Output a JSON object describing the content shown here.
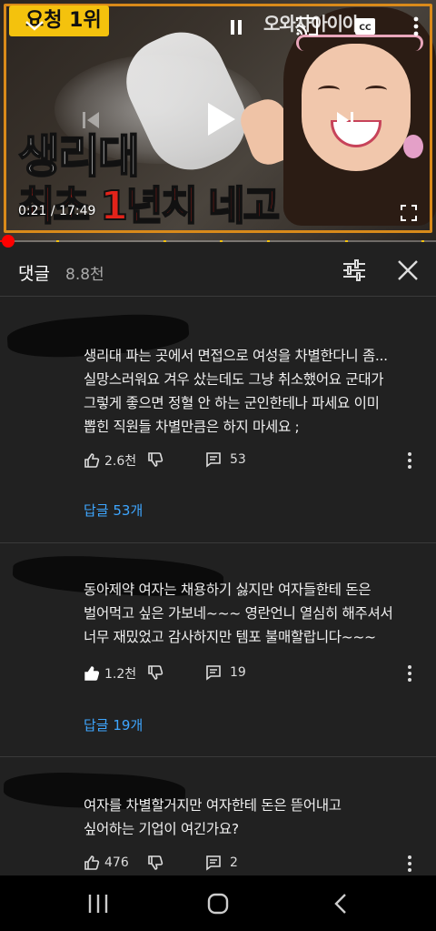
{
  "video": {
    "badge": "요청 1위",
    "corner_text": "오와사아이야",
    "title_line1": "생리대",
    "title_line2": "최초 1년치 네고",
    "current_time": "0:21",
    "duration": "17:49",
    "time_display": "0:21 / 17:49",
    "progress_fraction": 0.02,
    "colors": {
      "progress": "#ff0000",
      "segment_marker": "#f4c20d",
      "badge": "#f4c20d"
    }
  },
  "comments_header": {
    "title": "댓글",
    "count": "8.8천"
  },
  "comments": [
    {
      "lines": [
        "생리대 파는 곳에서 면접으로 여성을 차별한다니 좀...",
        "실망스러워요 겨우 샀는데도  그냥 취소했어요 군대가",
        "그렇게 좋으면 정혈 안 하는 군인한테나 파세요 이미",
        "뽑힌  직원들 차별만큼은 하지 마세요 ;"
      ],
      "likes": "2.6천",
      "reply_count": "53",
      "replies_link": "답글 53개"
    },
    {
      "lines": [
        "동아제약 여자는 채용하기 싫지만 여자들한테 돈은",
        "벌어먹고 싶은 가보네~~~ 영란언니 열심히 해주셔서",
        "너무 재밌었고 감사하지만 템포 불매할랍니다~~~"
      ],
      "likes": "1.2천",
      "reply_count": "19",
      "replies_link": "답글 19개"
    },
    {
      "lines": [
        "여자를 차별할거지만 여자한테 돈은 뜯어내고",
        "싶어하는 기업이 여긴가요?"
      ],
      "likes": "476",
      "reply_count": "2",
      "replies_link": ""
    }
  ],
  "icons": {
    "like": "thumbs-up-icon",
    "dislike": "thumbs-down-icon",
    "reply": "comment-icon",
    "more": "more-vertical-icon",
    "sort": "sort-filter-icon",
    "close": "close-icon"
  },
  "accent_link_color": "#3ea6ff"
}
